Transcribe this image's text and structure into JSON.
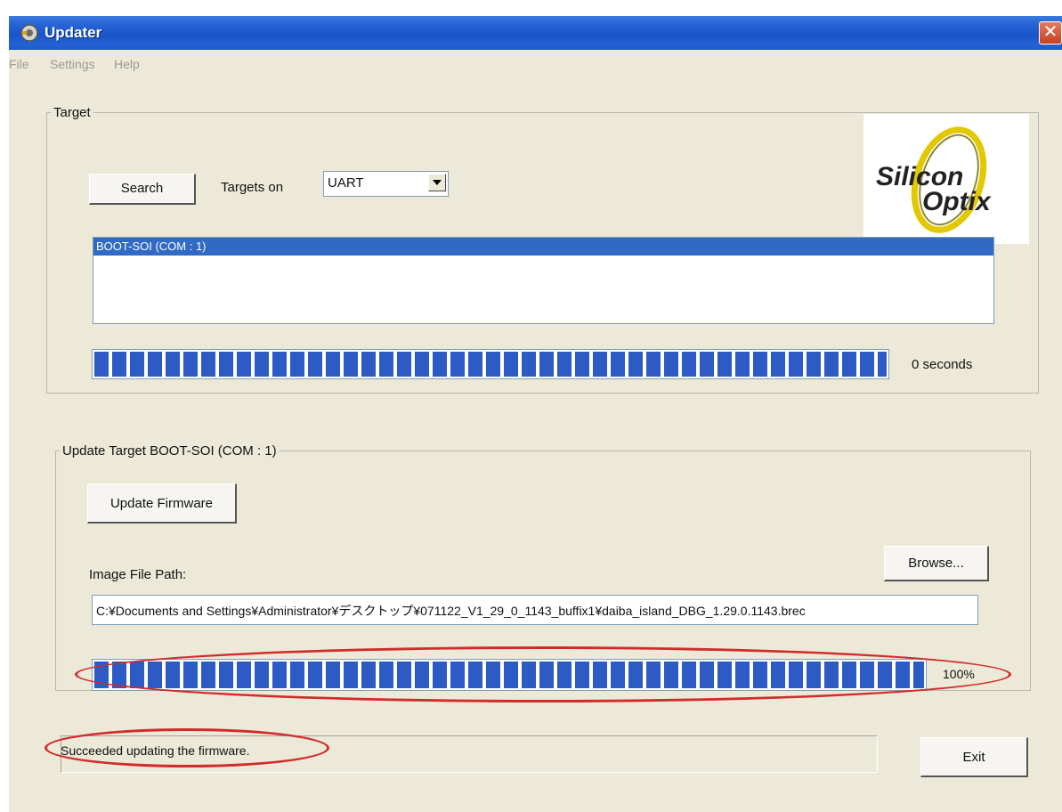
{
  "window": {
    "title": "Updater"
  },
  "menu": {
    "file": "File",
    "settings": "Settings",
    "help": "Help"
  },
  "target": {
    "legend": "Target",
    "search_label": "Search",
    "targets_on_label": "Targets on",
    "targets_on_value": "UART",
    "list_items": [
      "BOOT-SOI (COM : 1)"
    ],
    "progress": 1.0,
    "seconds_text": "0  seconds"
  },
  "logo": {
    "line1": "Silicon",
    "line2": "Optix"
  },
  "update": {
    "legend": "Update Target BOOT-SOI (COM : 1)",
    "update_label": "Update Firmware",
    "image_path_label": "Image File Path:",
    "browse_label": "Browse...",
    "file_path": "C:¥Documents and Settings¥Administrator¥デスクトップ¥071122_V1_29_0_1143_buffix1¥daiba_island_DBG_1.29.0.1143.brec",
    "progress": 1.0,
    "progress_text": "100%"
  },
  "status": {
    "message": "Succeeded updating the firmware."
  },
  "exit_label": "Exit",
  "colors": {
    "titlebar": "#245edb",
    "progress": "#2c5bc5",
    "highlight": "#d22b2b",
    "selection": "#316ac5"
  }
}
